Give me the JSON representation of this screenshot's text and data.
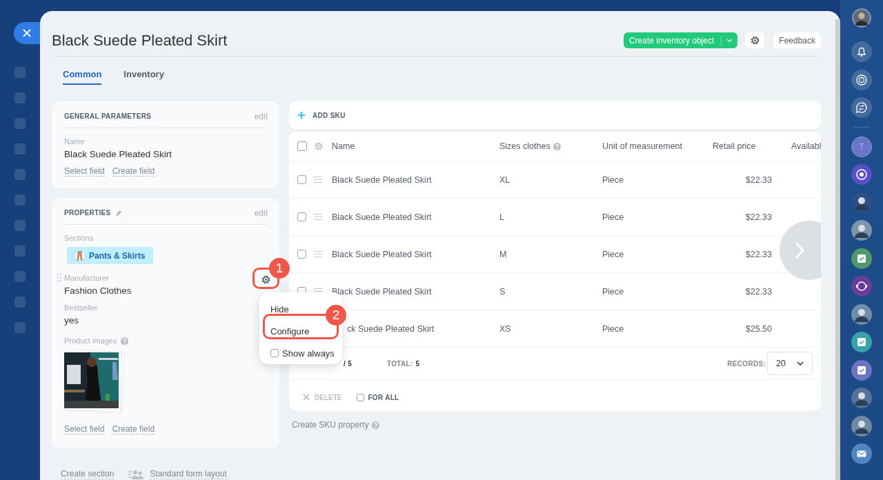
{
  "title": "Black Suede Pleated Skirt",
  "header_actions": {
    "create_button": "Create inventory object",
    "feedback_button": "Feedback"
  },
  "tabs": [
    {
      "label": "Common",
      "selected": true
    },
    {
      "label": "Inventory",
      "selected": false
    }
  ],
  "general_card": {
    "title": "GENERAL PARAMETERS",
    "edit": "edit",
    "fields": [
      {
        "label": "Name",
        "value": "Black Suede Pleated Skirt"
      }
    ],
    "links": [
      "Select field",
      "Create field"
    ]
  },
  "properties_card": {
    "title": "PROPERTIES",
    "edit": "edit",
    "sections_label": "Sections",
    "section_tag": "Pants & Skirts",
    "fields": [
      {
        "label": "Manufacturer",
        "value": "Fashion Clothes"
      },
      {
        "label": "Bestseller",
        "value": "yes"
      }
    ],
    "images_label": "Product images",
    "links": [
      "Select field",
      "Create field"
    ]
  },
  "footer_links": [
    "Create section",
    "Standard form layout"
  ],
  "sku": {
    "add_label": "ADD SKU",
    "columns": [
      "Name",
      "Sizes clothes",
      "Unit of measurement",
      "Retail price",
      "Availabl"
    ],
    "rows": [
      {
        "checked": false,
        "name": "Black Suede Pleated Skirt",
        "size": "XL",
        "unit": "Piece",
        "price": "$22.33"
      },
      {
        "checked": false,
        "name": "Black Suede Pleated Skirt",
        "size": "L",
        "unit": "Piece",
        "price": "$22.33"
      },
      {
        "checked": false,
        "name": "Black Suede Pleated Skirt",
        "size": "M",
        "unit": "Piece",
        "price": "$22.33"
      },
      {
        "checked": false,
        "name": "Black Suede Pleated Skirt",
        "size": "S",
        "unit": "Piece",
        "price": "$22.33"
      },
      {
        "name": "ck Suede Pleated Skirt",
        "size": "XS",
        "unit": "Piece",
        "price": "$25.50"
      }
    ],
    "select_all_checked": false,
    "selected_count": "/ 5",
    "total_label": "TOTAL:",
    "total_value": "5",
    "records_label": "RECORDS:",
    "records_value": "20",
    "delete_label": "DELETE",
    "for_all": {
      "label": "FOR ALL",
      "checked": false
    }
  },
  "create_sku_property": "Create SKU property",
  "field_menu": {
    "items": [
      {
        "kind": "action",
        "label": "Hide"
      },
      {
        "kind": "action",
        "label": "Configure"
      },
      {
        "kind": "checkbox",
        "label": "Show always",
        "checked": false
      }
    ]
  },
  "callouts": [
    "1",
    "2"
  ],
  "right_bar": {
    "letter": "T"
  }
}
